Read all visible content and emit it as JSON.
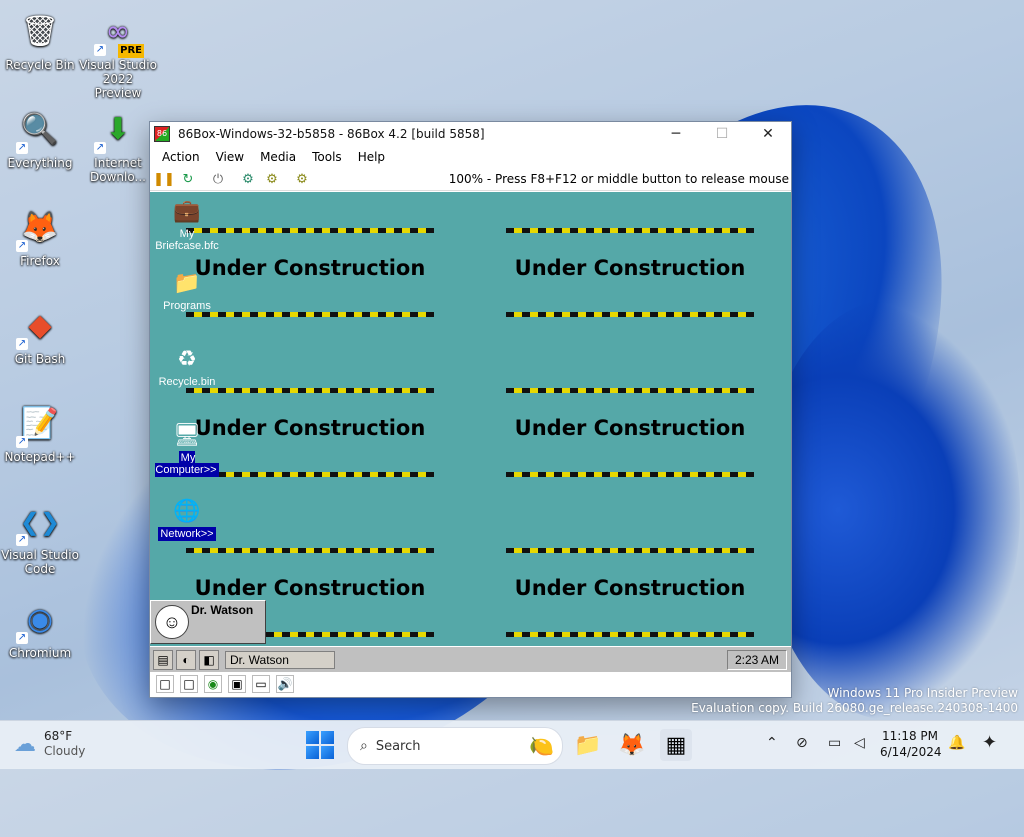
{
  "desktop": {
    "icons": [
      {
        "label": "Recycle Bin",
        "glyph": "🗑"
      },
      {
        "label": "Visual Studio 2022 Preview",
        "glyph": "∞",
        "badge": "PRE"
      },
      {
        "label": "Everything",
        "glyph": "🔍"
      },
      {
        "label": "Internet Downlo...",
        "glyph": "⬇"
      },
      {
        "label": "Firefox",
        "glyph": "🦊"
      },
      {
        "label": "Git Bash",
        "glyph": "◆"
      },
      {
        "label": "Notepad++",
        "glyph": "📝"
      },
      {
        "label": "Visual Studio Code",
        "glyph": "❮❯"
      },
      {
        "label": "Chromium",
        "glyph": "◉"
      }
    ]
  },
  "window": {
    "title": "86Box-Windows-32-b5858 - 86Box 4.2 [build 5858]",
    "minimize": "─",
    "maximize": "☐",
    "close": "✕",
    "menu": [
      "Action",
      "View",
      "Media",
      "Tools",
      "Help"
    ],
    "toolbar": {
      "buttons": [
        "pause",
        "reset",
        "power",
        "ctrl-alt-del",
        "ctrl-alt-esc",
        "settings"
      ],
      "glyphs": [
        "❚❚",
        "↻",
        "⏻",
        "⚙",
        "⚙",
        "⚙"
      ],
      "message": "100% - Press F8+F12 or middle button to release mouse"
    },
    "status_icons": [
      "□",
      "□",
      "◉",
      "▣",
      "▭",
      "🔊"
    ]
  },
  "guest": {
    "background": "#55a8a8",
    "under_construction": "Under Construction",
    "icons": [
      {
        "label": "My Briefcase.bfc",
        "glyph": "💼",
        "selected": false
      },
      {
        "label": "Programs",
        "glyph": "📁",
        "selected": false
      },
      {
        "label": "Recycle.bin",
        "glyph": "♻",
        "selected": false
      },
      {
        "label": "My Computer>>",
        "glyph": "🖥",
        "selected": true
      },
      {
        "label": "Network>>",
        "glyph": "🌐",
        "selected": true
      }
    ],
    "drwatson_popup": "Dr. Watson",
    "taskbar": {
      "task_button": "Dr. Watson",
      "clock": "2:23 AM"
    }
  },
  "watermark": {
    "line1": "Windows 11 Pro Insider Preview",
    "line2": "Evaluation copy. Build 26080.ge_release.240308-1400"
  },
  "taskbar": {
    "weather_temp": "68°F",
    "weather_desc": "Cloudy",
    "search_placeholder": "Search",
    "time": "11:18 PM",
    "date": "6/14/2024"
  }
}
